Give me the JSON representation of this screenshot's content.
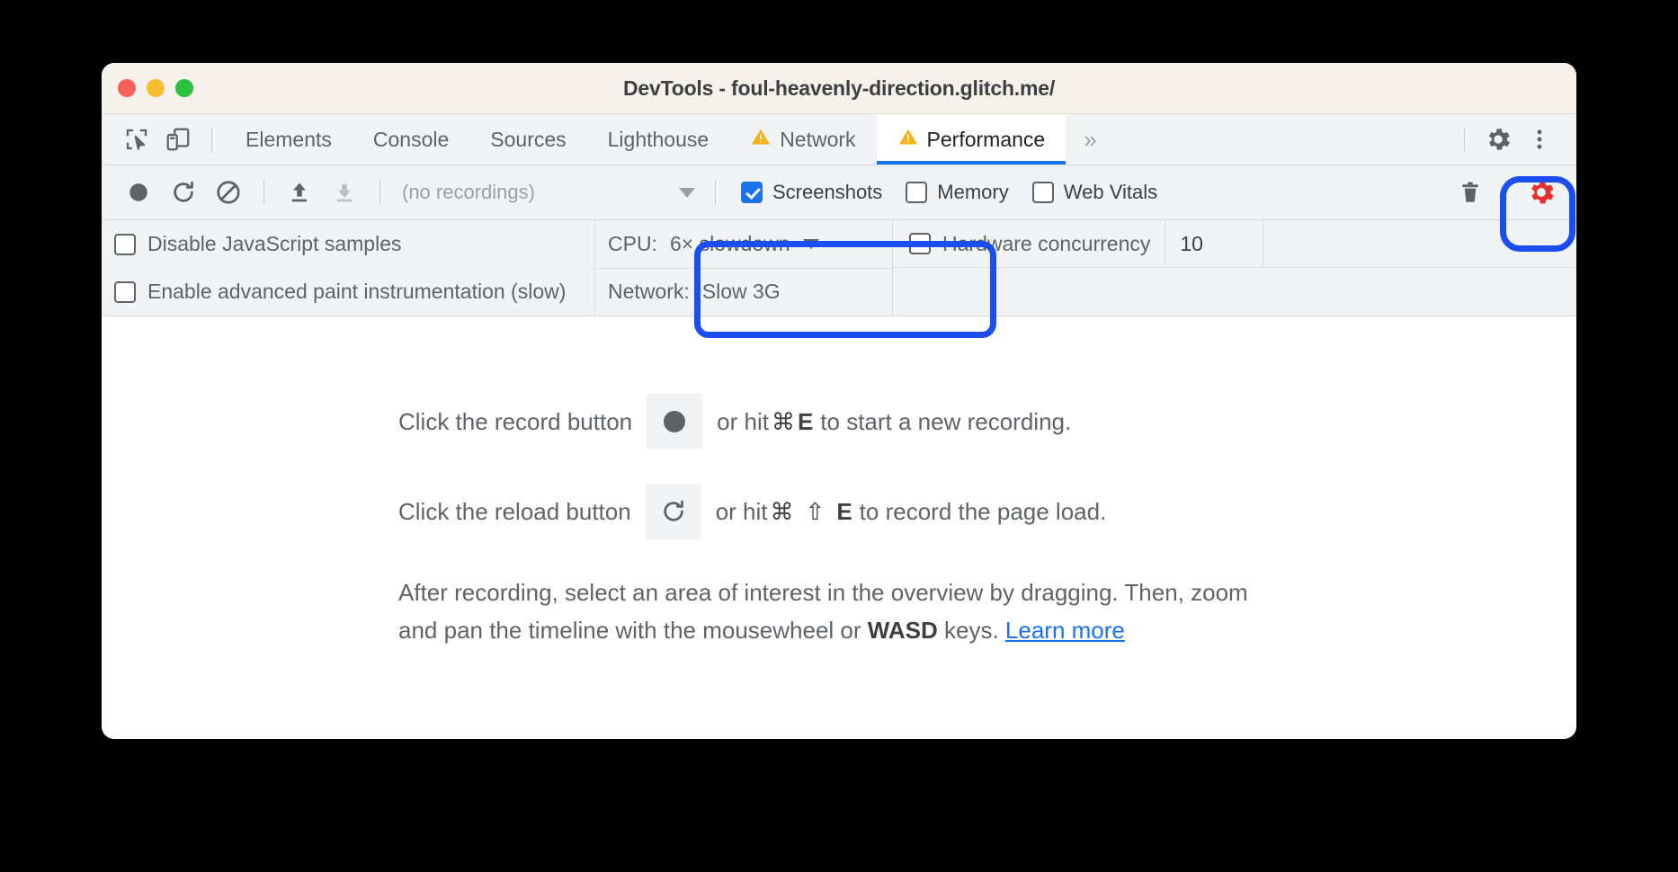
{
  "window": {
    "title": "DevTools - foul-heavenly-direction.glitch.me/",
    "traffic_lights": [
      "close",
      "minimize",
      "maximize"
    ]
  },
  "tabbar": {
    "inspect_icon": "inspect-cursor-icon",
    "device_icon": "device-toolbar-icon",
    "tabs": [
      {
        "label": "Elements",
        "warning": false,
        "active": false
      },
      {
        "label": "Console",
        "warning": false,
        "active": false
      },
      {
        "label": "Sources",
        "warning": false,
        "active": false
      },
      {
        "label": "Lighthouse",
        "warning": false,
        "active": false
      },
      {
        "label": "Network",
        "warning": true,
        "active": false
      },
      {
        "label": "Performance",
        "warning": true,
        "active": true
      }
    ],
    "overflow_label": "»",
    "settings_icon": "gear-icon",
    "more_icon": "three-dot-menu-icon"
  },
  "toolbar": {
    "record_title": "record-button",
    "reload_title": "reload-record-button",
    "clear_title": "clear-button",
    "import_title": "import-profile-button",
    "export_title": "export-profile-button",
    "recordings_value": "(no recordings)",
    "checkboxes": [
      {
        "label": "Screenshots",
        "checked": true
      },
      {
        "label": "Memory",
        "checked": false
      },
      {
        "label": "Web Vitals",
        "checked": false
      }
    ],
    "trash_title": "delete-recording-button",
    "capture_settings_title": "capture-settings-gear-button"
  },
  "settings": {
    "disable_js_samples": {
      "label": "Disable JavaScript samples",
      "checked": false
    },
    "advanced_paint": {
      "label": "Enable advanced paint instrumentation (slow)",
      "checked": false
    },
    "cpu": {
      "label": "CPU:",
      "value": "6× slowdown"
    },
    "network": {
      "label": "Network:",
      "value": "Slow 3G"
    },
    "hardware_concurrency": {
      "label": "Hardware concurrency",
      "checked": false,
      "value": "10"
    }
  },
  "content": {
    "record_line_pre": "Click the record button",
    "record_line_mid": "or hit",
    "record_key_cmd": "⌘",
    "record_key_letter": "E",
    "record_line_post": "to start a new recording.",
    "reload_line_pre": "Click the reload button",
    "reload_line_mid": "or hit",
    "reload_key_cmd": "⌘",
    "reload_key_shift": "⇧",
    "reload_key_letter": "E",
    "reload_line_post": "to record the page load.",
    "paragraph_a": "After recording, select an area of interest in the overview by dragging. Then, zoom and pan the timeline with the mousewheel or ",
    "paragraph_bold": "WASD",
    "paragraph_b": " keys. ",
    "learn_more": "Learn more"
  },
  "annotations": {
    "highlight_color": "#1a4ef0",
    "gear_highlight_color": "#e8302a",
    "items": [
      "capture-settings-gear",
      "throttling-controls"
    ]
  }
}
